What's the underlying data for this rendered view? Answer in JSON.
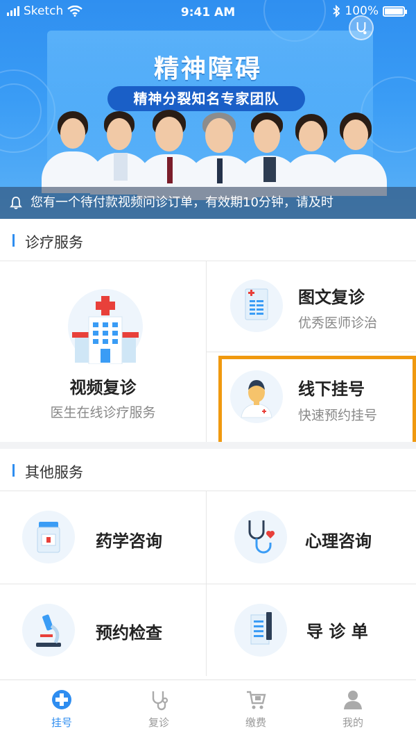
{
  "status_bar": {
    "carrier": "Sketch",
    "time": "9:41 AM",
    "battery": "100%"
  },
  "banner": {
    "title": "精神障碍",
    "subtitle": "精神分裂知名专家团队",
    "notice": "您有一个待付款视频问诊订单，有效期10分钟，请及时"
  },
  "sections": {
    "treatment": "诊疗服务",
    "other": "其他服务"
  },
  "treatment_services": {
    "video": {
      "title": "视频复诊",
      "subtitle": "医生在线诊疗服务",
      "icon": "hospital-icon"
    },
    "text": {
      "title": "图文复诊",
      "subtitle": "优秀医师诊治",
      "icon": "medical-form-icon"
    },
    "offline": {
      "title": "线下挂号",
      "subtitle": "快速预约挂号",
      "icon": "doctor-avatar-icon"
    }
  },
  "other_services": {
    "pharmacy": {
      "title": "药学咨询",
      "icon": "medicine-bottle-icon"
    },
    "psychology": {
      "title": "心理咨询",
      "icon": "stethoscope-heart-icon"
    },
    "exam": {
      "title": "预约检查",
      "icon": "microscope-icon"
    },
    "guide": {
      "title": "导 诊 单",
      "icon": "guide-sheet-icon"
    }
  },
  "tabs": [
    {
      "label": "挂号",
      "icon": "plus-cross-icon",
      "active": true
    },
    {
      "label": "复诊",
      "icon": "stethoscope-icon",
      "active": false
    },
    {
      "label": "缴费",
      "icon": "cart-icon",
      "active": false
    },
    {
      "label": "我的",
      "icon": "person-icon",
      "active": false
    }
  ],
  "colors": {
    "primary": "#2e8df0",
    "highlight": "#f0990f",
    "hospital_red": "#e8403a"
  }
}
